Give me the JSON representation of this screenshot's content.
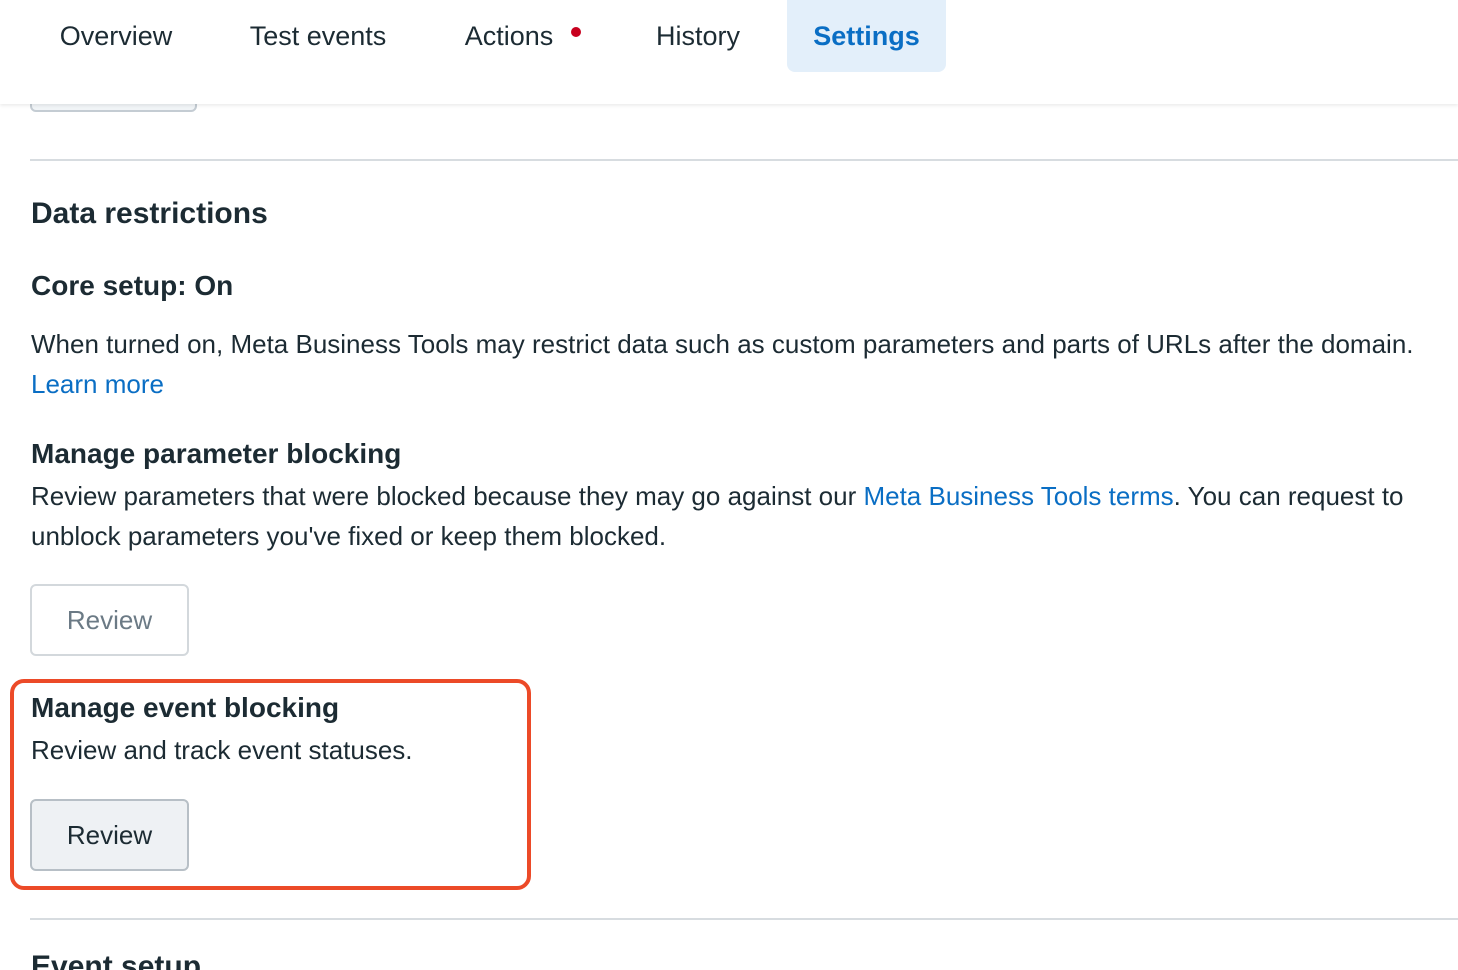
{
  "tabs": [
    {
      "label": "Overview",
      "active": false
    },
    {
      "label": "Test events",
      "active": false
    },
    {
      "label": "Actions",
      "active": false,
      "notification_dot": true
    },
    {
      "label": "History",
      "active": false
    },
    {
      "label": "Settings",
      "active": true
    }
  ],
  "colors": {
    "accent": "#0a6ec4",
    "active_tab_bg": "#e3effa",
    "notification_dot": "#c8001e",
    "highlight_border": "#ec4a28"
  },
  "data_restrictions": {
    "title": "Data restrictions",
    "core_setup": {
      "title": "Core setup: On",
      "text": "When turned on, Meta Business Tools may restrict data such as custom parameters and parts of URLs after the domain. ",
      "link": "Learn more"
    },
    "parameter_blocking": {
      "title": "Manage parameter blocking",
      "text_before": "Review parameters that were blocked because they may go against our ",
      "link": "Meta Business Tools terms",
      "text_after": ". You can request to unblock parameters you've fixed or keep them blocked.",
      "button_label": "Review"
    },
    "event_blocking": {
      "title": "Manage event blocking",
      "text": "Review and track event statuses.",
      "button_label": "Review"
    }
  },
  "next_section": {
    "title": "Event setup"
  }
}
